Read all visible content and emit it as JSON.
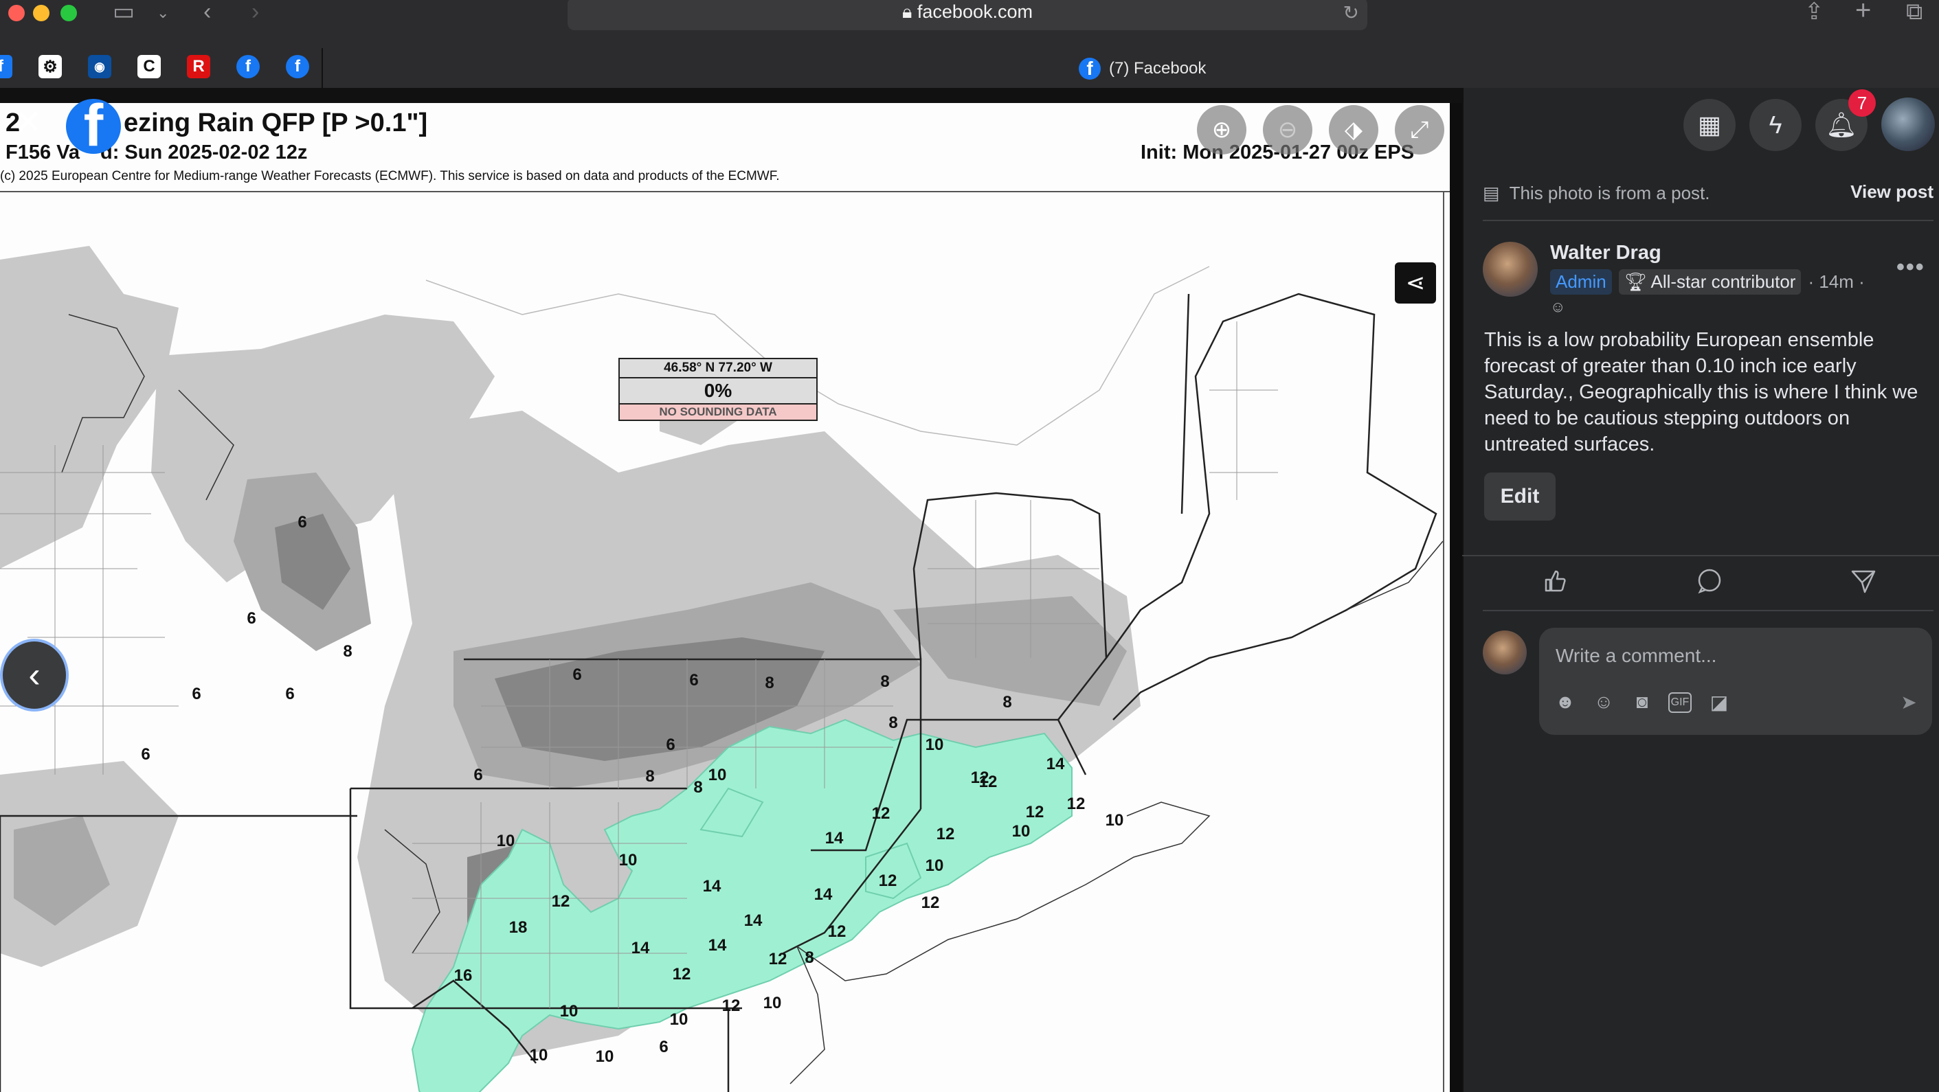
{
  "browser": {
    "url": "facebook.com",
    "tab_title": "(7) Facebook"
  },
  "map": {
    "title": "24-hr Freezing Rain QFP [P >0.1\"]",
    "title_visible_left": "2",
    "title_visible_right": "ezing Rain QFP [P >0.1\"]",
    "valid_prefix": "F156 Va",
    "valid_suffix": "d: Sun 2025-02-02 12z",
    "init": "Init: Mon 2025-01-27 00z EPS",
    "copyright": "(c) 2025 European Centre for Medium-range Weather Forecasts (ECMWF). This service is based on data and products of the ECMWF.",
    "probe_coords": "46.58° N 77.20° W",
    "probe_value": "0%",
    "probe_note": "NO SOUNDING DATA",
    "contour_labels": [
      "6",
      "6",
      "8",
      "6",
      "6",
      "6",
      "6",
      "6",
      "8",
      "8",
      "8",
      "6",
      "8",
      "6",
      "8",
      "8",
      "10",
      "10",
      "10",
      "10",
      "12",
      "12",
      "12",
      "12",
      "14",
      "14",
      "14",
      "14",
      "14",
      "12",
      "12",
      "12",
      "12",
      "10",
      "14",
      "12",
      "14",
      "12",
      "10",
      "18",
      "16",
      "12",
      "12",
      "10",
      "10",
      "10",
      "10",
      "6",
      "10",
      "12",
      "10",
      "8",
      "10",
      "6"
    ]
  },
  "panel": {
    "notification_count": "7",
    "from_post": "This photo is from a post.",
    "view_post": "View post",
    "author": "Walter Drag",
    "admin_badge": "Admin",
    "contributor_badge": "All-star contributor",
    "timestamp": "· 14m ·",
    "post_text": "This is a low probability European ensemble forecast of greater than 0.10 inch ice early Saturday., Geographically this is where I think we need to be cautious stepping outdoors on untreated surfaces.",
    "edit_label": "Edit",
    "comment_placeholder": "Write a comment..."
  },
  "colors": {
    "facebook_blue": "#1877f2",
    "freezing_rain_fill": "#9ff0d2",
    "notification_red": "#e41e3f"
  },
  "icons": [
    "sidebar-icon",
    "back-icon",
    "forward-icon",
    "lock-icon",
    "reload-icon",
    "share-icon",
    "new-tab-icon",
    "tabs-icon",
    "zoom-in-icon",
    "zoom-out-icon",
    "tag-icon",
    "fullscreen-icon",
    "grid-menu-icon",
    "messenger-icon",
    "bell-icon",
    "like-icon",
    "comment-icon",
    "send-icon"
  ]
}
